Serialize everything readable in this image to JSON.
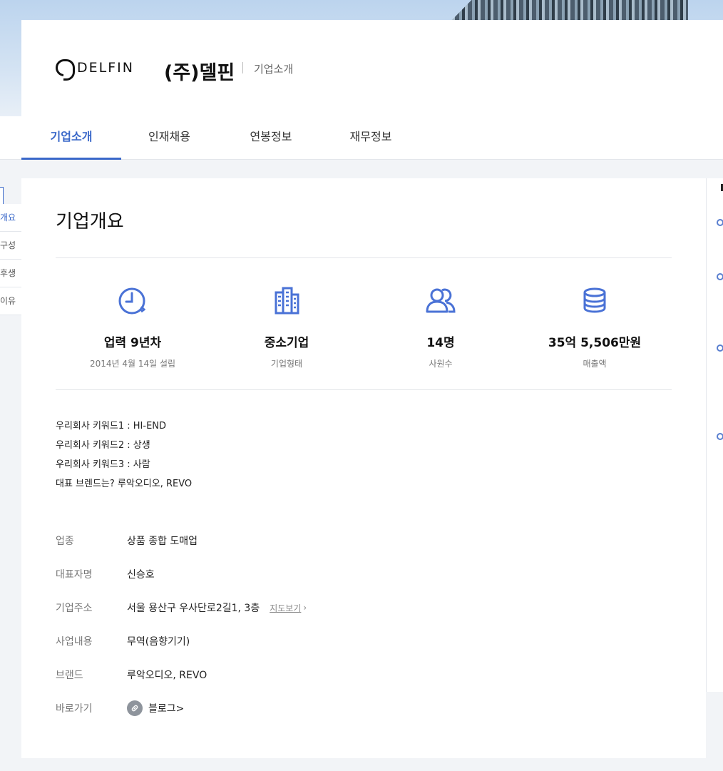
{
  "header": {
    "logo_text": "DELFIN",
    "company_name": "(주)델핀",
    "subtitle": "기업소개"
  },
  "tabs": [
    {
      "label": "기업소개",
      "active": true
    },
    {
      "label": "인재채용",
      "active": false
    },
    {
      "label": "연봉정보",
      "active": false
    },
    {
      "label": "재무정보",
      "active": false
    }
  ],
  "left_nav": {
    "items": [
      {
        "label": "개요",
        "active": true
      },
      {
        "label": "구성",
        "active": false
      },
      {
        "label": "후생",
        "active": false
      },
      {
        "label": "이유",
        "active": false
      }
    ]
  },
  "main": {
    "title": "기업개요",
    "stats": [
      {
        "icon": "clock-icon",
        "value": "업력 9년차",
        "label": "2014년 4월 14일 설립"
      },
      {
        "icon": "building-icon",
        "value": "중소기업",
        "label": "기업형태"
      },
      {
        "icon": "people-icon",
        "value": "14명",
        "label": "사원수"
      },
      {
        "icon": "coins-icon",
        "value": "35억 5,506만원",
        "label": "매출액"
      }
    ],
    "keywords": [
      "우리회사 키워드1 : HI-END",
      "우리회사 키워드2 : 상생",
      "우리회사 키워드3 : 사람",
      "대표 브렌드는? 루악오디오, REVO"
    ],
    "info": {
      "industry_label": "업종",
      "industry_value": "상품 종합 도매업",
      "ceo_label": "대표자명",
      "ceo_value": "신승호",
      "address_label": "기업주소",
      "address_value": "서울 용산구 우사단로2길1, 3층",
      "map_link": "지도보기",
      "business_label": "사업내용",
      "business_value": "무역(음향기기)",
      "brand_label": "브랜드",
      "brand_value": "루악오디오, REVO",
      "shortcut_label": "바로가기",
      "blog_link": "블로그>"
    }
  },
  "colors": {
    "accent": "#3a68c9",
    "icon": "#4a72d6"
  }
}
